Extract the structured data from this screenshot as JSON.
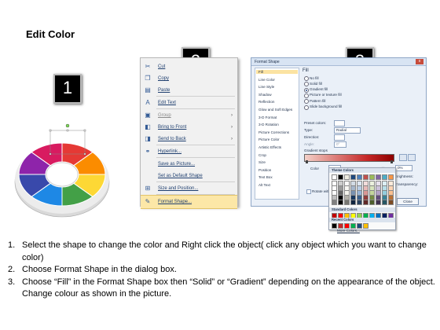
{
  "title": "Edit Color",
  "steps_badges": [
    "1",
    "2",
    "3"
  ],
  "context_menu": {
    "items": [
      {
        "icon": "scissors-icon",
        "glyph": "✂",
        "label": "Cut",
        "arrow": false,
        "disabled": false,
        "highlight": false
      },
      {
        "icon": "copy-icon",
        "glyph": "❐",
        "label": "Copy",
        "arrow": false,
        "disabled": false,
        "highlight": false
      },
      {
        "icon": "paste-icon",
        "glyph": "▤",
        "label": "Paste",
        "arrow": false,
        "disabled": false,
        "highlight": false
      },
      {
        "icon": "edit-text-icon",
        "glyph": "A",
        "label": "Edit Text",
        "arrow": false,
        "disabled": false,
        "highlight": false
      },
      {
        "icon": "group-icon",
        "glyph": "▣",
        "label": "Group",
        "arrow": true,
        "disabled": true,
        "highlight": false
      },
      {
        "icon": "bring-to-front-icon",
        "glyph": "◧",
        "label": "Bring to Front",
        "arrow": true,
        "disabled": false,
        "highlight": false
      },
      {
        "icon": "send-to-back-icon",
        "glyph": "◨",
        "label": "Send to Back",
        "arrow": true,
        "disabled": false,
        "highlight": false
      },
      {
        "icon": "hyperlink-icon",
        "glyph": "⚭",
        "label": "Hyperlink...",
        "arrow": false,
        "disabled": false,
        "highlight": false
      },
      {
        "icon": "none",
        "glyph": "",
        "label": "Save as Picture...",
        "arrow": false,
        "disabled": false,
        "highlight": false
      },
      {
        "icon": "none",
        "glyph": "",
        "label": "Set as Default Shape",
        "arrow": false,
        "disabled": false,
        "highlight": false
      },
      {
        "icon": "size-position-icon",
        "glyph": "⊞",
        "label": "Size and Position...",
        "arrow": false,
        "disabled": false,
        "highlight": false
      },
      {
        "icon": "format-shape-icon",
        "glyph": "✎",
        "label": "Format Shape...",
        "arrow": false,
        "disabled": false,
        "highlight": true
      }
    ]
  },
  "format_dialog": {
    "title": "Format Shape",
    "close_glyph": "x",
    "nav": [
      "Fill",
      "Line Color",
      "Line Style",
      "Shadow",
      "Reflection",
      "Glow and Soft Edges",
      "3-D Format",
      "3-D Rotation",
      "Picture Corrections",
      "Picture Color",
      "Artistic Effects",
      "Crop",
      "Size",
      "Position",
      "Text Box",
      "Alt Text"
    ],
    "nav_selected": "Fill",
    "panel_heading": "Fill",
    "fill_options": [
      "No fill",
      "Solid fill",
      "Gradient fill",
      "Picture or texture fill",
      "Pattern fill",
      "Slide background fill"
    ],
    "fill_selected": "Gradient fill",
    "preset_label": "Preset colors:",
    "type_label": "Type:",
    "type_value": "Radial",
    "direction_label": "Direction:",
    "angle_label": "Angle:",
    "angle_value": "0°",
    "gradient_stops_label": "Gradient stops",
    "color_label": "Color",
    "position_label": "Position:",
    "position_value": "0%",
    "brightness_label": "Brightness:",
    "transparency_label": "Transparency:",
    "rotate_label": "Rotate with shape",
    "close_button": "Close",
    "colors": {
      "gradient_main": "#c62828",
      "highlight": "#fbe3a2"
    }
  },
  "palette": {
    "theme_label": "Theme Colors",
    "standard_label": "Standard Colors",
    "recent_label": "Recent Colors",
    "more_label": "More Colors...",
    "theme_top": [
      "#ffffff",
      "#000000",
      "#eeece1",
      "#1f497d",
      "#4f81bd",
      "#c0504d",
      "#9bbb59",
      "#8064a2",
      "#4bacc6",
      "#f79646"
    ],
    "standard": [
      "#c00000",
      "#ff0000",
      "#ffc000",
      "#ffff00",
      "#92d050",
      "#00b050",
      "#00b0f0",
      "#0070c0",
      "#002060",
      "#7030a0"
    ],
    "recent": [
      "#000000",
      "#c62828",
      "#ff0000",
      "#00b050",
      "#1f497d",
      "#ffc000"
    ]
  },
  "wheel": {
    "segment_colors": [
      "#e53935",
      "#fb8c00",
      "#fdd835",
      "#43a047",
      "#1e88e5",
      "#3949ab",
      "#8e24aa",
      "#d81b60"
    ]
  },
  "instructions": [
    {
      "n": "1.",
      "text": "Select the shape to change the color and Right click the object( click any object which you want to change color)"
    },
    {
      "n": "2.",
      "text": "Choose Format Shape in the dialog box."
    },
    {
      "n": "3.",
      "text": "Choose “Fill” in the Format Shape box then “Solid” or “Gradient” depending on the appearance of the object. Change colour as shown in the picture."
    }
  ]
}
